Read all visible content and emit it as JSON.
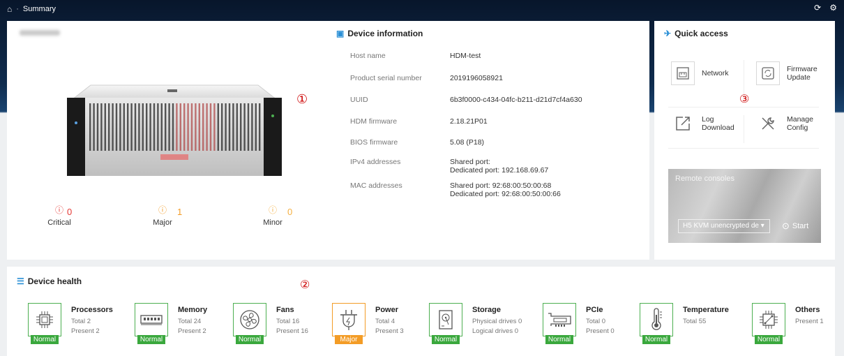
{
  "header": {
    "title": "Summary"
  },
  "device_panel": {
    "title": "Device information",
    "annotation_1": "①",
    "alarms": [
      {
        "label": "Critical",
        "count": "0",
        "color": "#e53935"
      },
      {
        "label": "Major",
        "count": "1",
        "color": "#f39c26"
      },
      {
        "label": "Minor",
        "count": "0",
        "color": "#f5b041"
      }
    ],
    "info": [
      {
        "key": "Host name",
        "value": "HDM-test"
      },
      {
        "key": "Product serial number",
        "value": "2019196058921"
      },
      {
        "key": "UUID",
        "value": "6b3f0000-c434-04fc-b211-d21d7cf4a630"
      },
      {
        "key": "HDM firmware",
        "value": "2.18.21P01"
      },
      {
        "key": "BIOS firmware",
        "value": "5.08 (P18)"
      },
      {
        "key": "IPv4 addresses",
        "value": "Shared port:",
        "value2": "Dedicated port: 192.168.69.67"
      },
      {
        "key": "MAC addresses",
        "value": "Shared port: 92:68:00:50:00:68",
        "value2": "Dedicated port: 92:68:00:50:00:66"
      }
    ]
  },
  "quick_access": {
    "title": "Quick access",
    "annotation_3": "③",
    "items": [
      {
        "label": "Network"
      },
      {
        "label": "Firmware",
        "label2": "Update"
      },
      {
        "label": "Log",
        "label2": "Download"
      },
      {
        "label": "Manage",
        "label2": "Config"
      }
    ],
    "remote": {
      "title": "Remote consoles",
      "select_value": "H5 KVM unencrypted de",
      "start_label": "Start"
    }
  },
  "health": {
    "title": "Device health",
    "annotation_2": "②",
    "items": [
      {
        "name": "Processors",
        "line1": "Total 2",
        "line2": "Present 2",
        "status": "Normal"
      },
      {
        "name": "Memory",
        "line1": "Total 24",
        "line2": "Present 2",
        "status": "Normal"
      },
      {
        "name": "Fans",
        "line1": "Total 16",
        "line2": "Present 16",
        "status": "Normal"
      },
      {
        "name": "Power",
        "line1": "Total 4",
        "line2": "Present 3",
        "status": "Major"
      },
      {
        "name": "Storage",
        "line1": "Physical drives 0",
        "line2": "Logical drives 0",
        "status": "Normal"
      },
      {
        "name": "PCIe",
        "line1": "Total 0",
        "line2": "Present 0",
        "status": "Normal"
      },
      {
        "name": "Temperature",
        "line1": "Total 55",
        "status": "Normal"
      },
      {
        "name": "Others",
        "line1": "Present 1",
        "status": "Normal"
      }
    ]
  }
}
